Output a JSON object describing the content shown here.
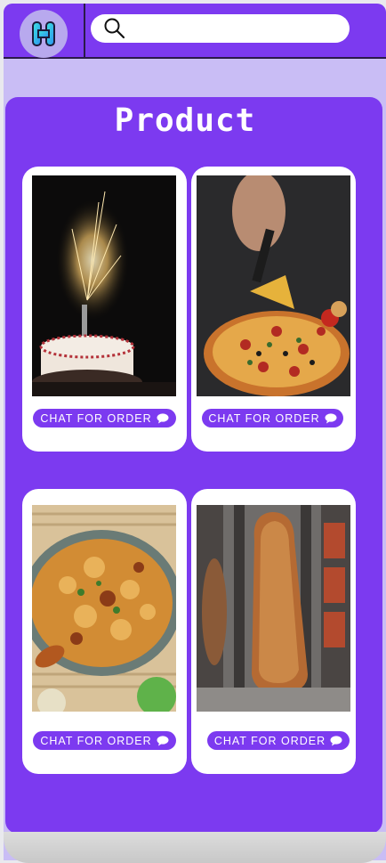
{
  "header": {
    "logo_icon": "app-logo-h-icon",
    "search": {
      "icon": "search-icon",
      "placeholder": "",
      "value": ""
    }
  },
  "main": {
    "title": "Product",
    "products": [
      {
        "image": "birthday cake with sparkler candle",
        "button_label": "CHAT FOR ORDER",
        "button_icon": "speech-bubble-icon"
      },
      {
        "image": "pizza slice being lifted",
        "button_label": "CHAT FOR ORDER",
        "button_icon": "speech-bubble-icon"
      },
      {
        "image": "chicken biryani bowl",
        "button_label": "CHAT FOR ORDER",
        "button_icon": "speech-bubble-icon"
      },
      {
        "image": "shawarma on rotisserie",
        "button_label": "CHAT FOR ORDER",
        "button_icon": "speech-bubble-icon"
      }
    ]
  },
  "colors": {
    "brand_purple": "#7c3af0",
    "light_lavender": "#c9bdf5",
    "card_white": "#ffffff"
  }
}
